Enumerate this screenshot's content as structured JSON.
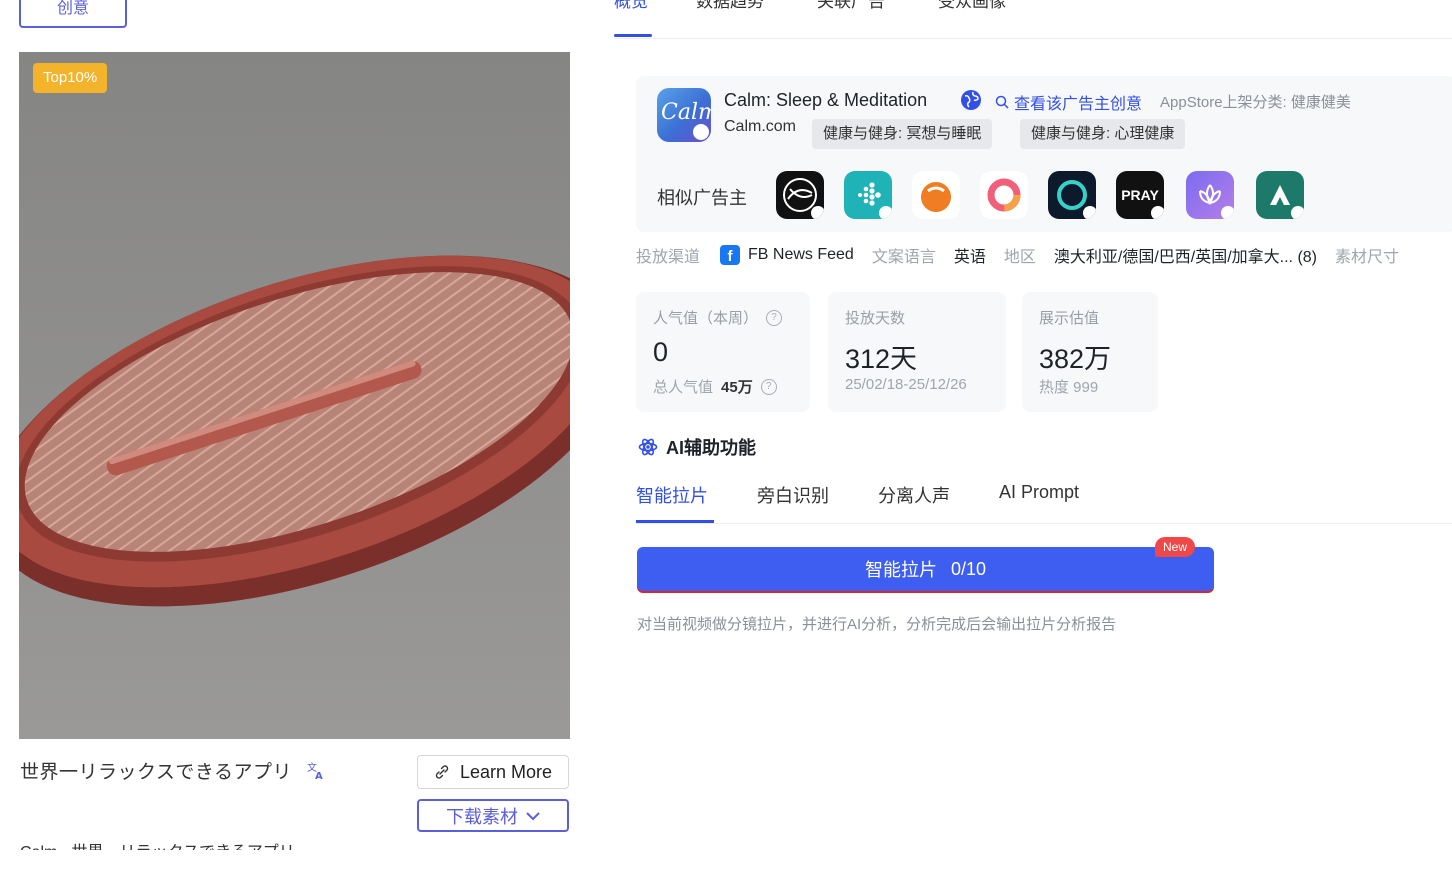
{
  "left": {
    "top_button_label": "创意",
    "badge": "Top10%",
    "caption": "世界一リラックスできるアプリ",
    "learn_more": "Learn More",
    "download_label": "下载素材",
    "cut_text": "Calm - 世界一リラックスできるアプリ"
  },
  "nav": {
    "tabs": [
      "概览",
      "数据趋势",
      "关联广告",
      "受众画像"
    ]
  },
  "advertiser": {
    "app_name": "Calm: Sleep & Meditation",
    "view_creatives": "查看该广告主创意",
    "store_category": "AppStore上架分类:  健康健美",
    "domain": "Calm.com",
    "tags": [
      "健康与健身: 冥想与睡眠",
      "健康与健身: 心理健康"
    ],
    "similar_label": "相似广告主",
    "similar_icons": [
      "dark-swirl-app-icon",
      "fitbit-app-icon",
      "orange-face-app-icon",
      "pink-ring-app-icon",
      "teal-ring-app-icon",
      "pray-app-icon",
      "purple-lotus-app-icon",
      "green-a-app-icon"
    ],
    "pray_text": "PRAY"
  },
  "meta": {
    "channel_label": "投放渠道",
    "channel_value": "FB News Feed",
    "language_label": "文案语言",
    "language_value": "英语",
    "region_label": "地区",
    "region_value": "澳大利亚/德国/巴西/英国/加拿大... (8)",
    "size_label": "素材尺寸"
  },
  "stats": {
    "popularity_label": "人气值（本周）",
    "popularity_value": "0",
    "popularity_total_label": "总人气值",
    "popularity_total": "45万",
    "days_label": "投放天数",
    "days_value": "312天",
    "days_range": "25/02/18-25/12/26",
    "impressions_label": "展示估值",
    "impressions_value": "382万",
    "heat_label": "热度 999"
  },
  "ai": {
    "title": "AI辅助功能",
    "tabs": [
      "智能拉片",
      "旁白识别",
      "分离人声",
      "AI Prompt"
    ],
    "button_label": "智能拉片",
    "button_count": "0/10",
    "new_badge": "New",
    "description": "对当前视频做分镜拉片，并进行AI分析，分析完成后会输出拉片分析报告"
  },
  "colors": {
    "accent": "#3350e6",
    "button": "#3d5ef0",
    "badge": "#f3b32b",
    "new_badge": "#f04848"
  }
}
